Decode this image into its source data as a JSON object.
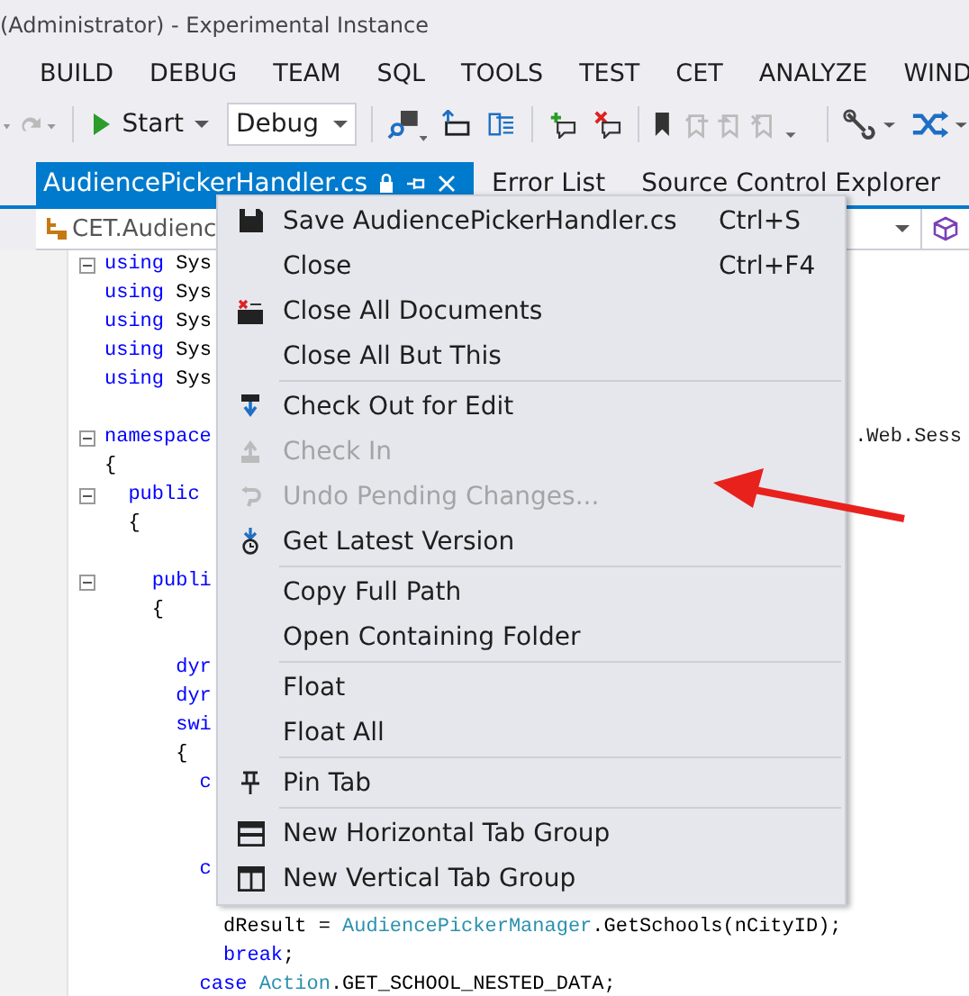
{
  "window": {
    "title": "(Administrator) - Experimental Instance"
  },
  "menu_bar": [
    "BUILD",
    "DEBUG",
    "TEAM",
    "SQL",
    "TOOLS",
    "TEST",
    "CET",
    "ANALYZE",
    "WIND"
  ],
  "toolbar": {
    "start_label": "Start",
    "configuration": "Debug"
  },
  "tabs": [
    {
      "label": "AudiencePickerHandler.cs",
      "selected": true
    },
    {
      "label": "Error List",
      "selected": false
    },
    {
      "label": "Source Control Explorer",
      "selected": false
    }
  ],
  "nav_bar": {
    "scope": "CET.Audienc"
  },
  "code_lines": [
    {
      "segments": [
        {
          "t": "using",
          "kind": "keyword"
        },
        {
          "t": " Sys",
          "kind": "plain"
        }
      ],
      "collapsible": true
    },
    {
      "segments": [
        {
          "t": "using",
          "kind": "keyword"
        },
        {
          "t": " Sys",
          "kind": "plain"
        }
      ],
      "collapsible": false
    },
    {
      "segments": [
        {
          "t": "using",
          "kind": "keyword"
        },
        {
          "t": " Sys",
          "kind": "plain"
        }
      ],
      "collapsible": false
    },
    {
      "segments": [
        {
          "t": "using",
          "kind": "keyword"
        },
        {
          "t": " Sys",
          "kind": "plain"
        }
      ],
      "collapsible": false
    },
    {
      "segments": [
        {
          "t": "using",
          "kind": "keyword"
        },
        {
          "t": " Sys",
          "kind": "plain"
        }
      ],
      "collapsible": false
    },
    {
      "collapsible": false
    },
    {
      "segments": [
        {
          "t": "namespace",
          "kind": "keyword"
        }
      ],
      "collapsible": true,
      "tail": ".Web.Sess"
    },
    {
      "segments": [
        {
          "t": "{",
          "kind": "plain"
        }
      ],
      "collapsible": false
    },
    {
      "segments": [
        {
          "t": "  public",
          "kind": "keyword"
        }
      ],
      "collapsible": true
    },
    {
      "segments": [
        {
          "t": "  {",
          "kind": "plain"
        }
      ],
      "collapsible": false
    },
    {
      "collapsible": false
    },
    {
      "segments": [
        {
          "t": "    publi",
          "kind": "keyword"
        }
      ],
      "collapsible": true
    },
    {
      "segments": [
        {
          "t": "    {",
          "kind": "plain"
        }
      ],
      "collapsible": false
    },
    {
      "collapsible": false
    },
    {
      "segments": [
        {
          "t": "      dyr",
          "kind": "keyword"
        }
      ],
      "collapsible": false
    },
    {
      "segments": [
        {
          "t": "      dyr",
          "kind": "keyword"
        }
      ],
      "collapsible": false
    },
    {
      "segments": [
        {
          "t": "      swi",
          "kind": "keyword"
        }
      ],
      "collapsible": false
    },
    {
      "segments": [
        {
          "t": "      {",
          "kind": "plain"
        }
      ],
      "collapsible": false
    },
    {
      "segments": [
        {
          "t": "        c",
          "kind": "keyword"
        }
      ],
      "collapsible": false
    },
    {
      "collapsible": false
    },
    {
      "collapsible": false
    },
    {
      "segments": [
        {
          "t": "        c",
          "kind": "keyword"
        }
      ],
      "collapsible": false
    },
    {
      "collapsible": false
    },
    {
      "segments": [
        {
          "t": "          dResult = ",
          "kind": "plain"
        },
        {
          "t": "AudiencePickerManager",
          "kind": "type"
        },
        {
          "t": ".GetSchools(nCityID);",
          "kind": "plain"
        }
      ],
      "collapsible": false
    },
    {
      "segments": [
        {
          "t": "          break",
          "kind": "keyword"
        },
        {
          "t": ";",
          "kind": "plain"
        }
      ],
      "collapsible": false
    },
    {
      "segments": [
        {
          "t": "        case ",
          "kind": "keyword"
        },
        {
          "t": "Action",
          "kind": "type"
        },
        {
          "t": ".GET_SCHOOL_NESTED_DATA;",
          "kind": "plain"
        }
      ],
      "collapsible": false
    }
  ],
  "context_menu": [
    {
      "kind": "save",
      "label": "Save AudiencePickerHandler.cs",
      "shortcut": "Ctrl+S",
      "disabled": false,
      "separator_before": false
    },
    {
      "kind": "plain",
      "label": "Close",
      "shortcut": "Ctrl+F4",
      "disabled": false,
      "separator_before": false
    },
    {
      "kind": "close-all",
      "label": "Close All Documents",
      "disabled": false,
      "separator_before": false
    },
    {
      "kind": "plain",
      "label": "Close All But This",
      "disabled": false,
      "separator_before": false
    },
    {
      "kind": "check-out",
      "label": "Check Out for Edit",
      "disabled": false,
      "separator_before": true
    },
    {
      "kind": "check-in",
      "label": "Check In",
      "disabled": true,
      "separator_before": false
    },
    {
      "kind": "undo",
      "label": "Undo Pending Changes...",
      "disabled": true,
      "separator_before": false
    },
    {
      "kind": "get-latest",
      "label": "Get Latest Version",
      "disabled": false,
      "separator_before": false
    },
    {
      "kind": "plain",
      "label": "Copy Full Path",
      "disabled": false,
      "separator_before": true
    },
    {
      "kind": "plain",
      "label": "Open Containing Folder",
      "disabled": false,
      "separator_before": false
    },
    {
      "kind": "plain",
      "label": "Float",
      "disabled": false,
      "separator_before": true
    },
    {
      "kind": "plain",
      "label": "Float All",
      "disabled": false,
      "separator_before": false
    },
    {
      "kind": "pin",
      "label": "Pin Tab",
      "disabled": false,
      "separator_before": true
    },
    {
      "kind": "horizontal",
      "label": "New Horizontal Tab Group",
      "disabled": false,
      "separator_before": true
    },
    {
      "kind": "vertical",
      "label": "New Vertical Tab Group",
      "disabled": false,
      "separator_before": false
    }
  ]
}
